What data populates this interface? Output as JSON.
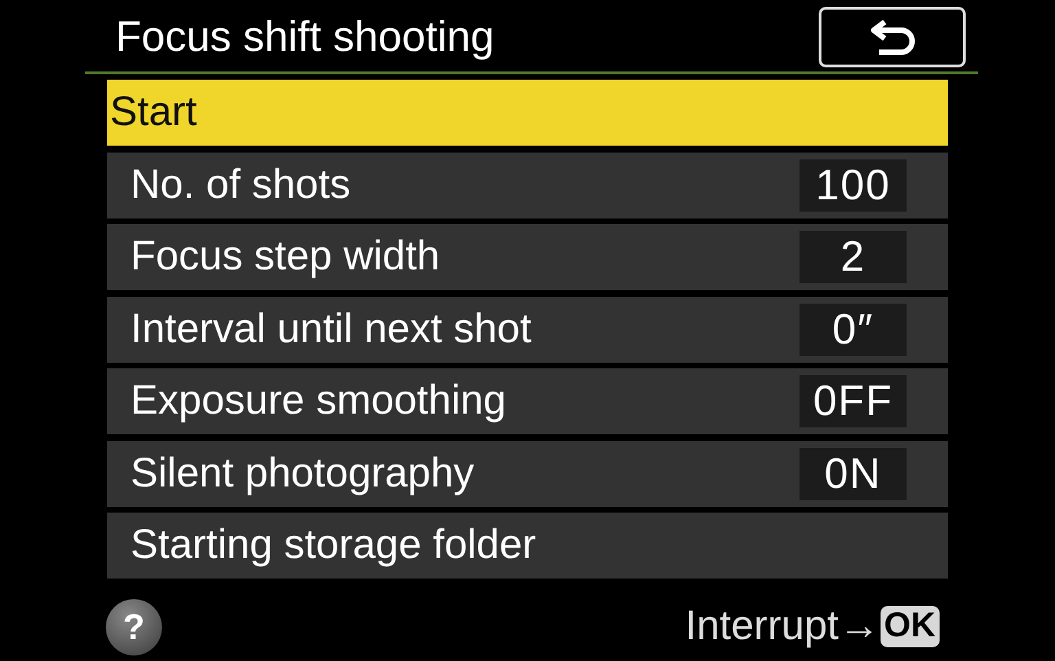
{
  "title": "Focus shift shooting",
  "items": [
    {
      "label": "Start",
      "selected": true
    },
    {
      "label": "No. of shots",
      "value": "100",
      "selected": false
    },
    {
      "label": "Focus step width",
      "value": "2",
      "selected": false
    },
    {
      "label": "Interval until next shot",
      "value": "0″",
      "selected": false
    },
    {
      "label": "Exposure smoothing",
      "value": "0FF",
      "selected": false
    },
    {
      "label": "Silent photography",
      "value": "0N",
      "selected": false
    },
    {
      "label": "Starting storage folder",
      "selected": false
    }
  ],
  "footer": {
    "help": "?",
    "hint": "Interrupt→",
    "key": "OK"
  }
}
